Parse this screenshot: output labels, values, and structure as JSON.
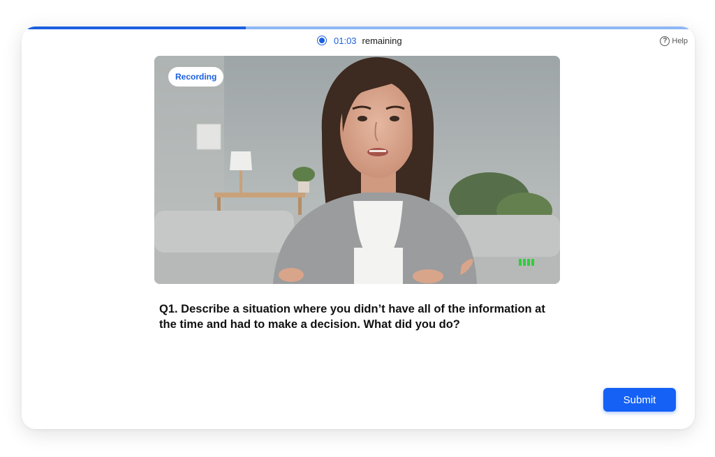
{
  "progress": {
    "fraction": 0.33
  },
  "timer": {
    "time": "01:03",
    "suffix": "remaining"
  },
  "help": {
    "label": "Help",
    "icon": "help-circle-icon"
  },
  "video": {
    "badge": "Recording",
    "audio_bars_active": 4
  },
  "question": {
    "text": "Q1. Describe a situation where you didn’t have all of the information at the time and had to make a decision. What did you do?"
  },
  "actions": {
    "submit_label": "Submit"
  },
  "colors": {
    "accent": "#1a5fe0",
    "button": "#1561f5",
    "audio_meter": "#2fcf3a"
  }
}
